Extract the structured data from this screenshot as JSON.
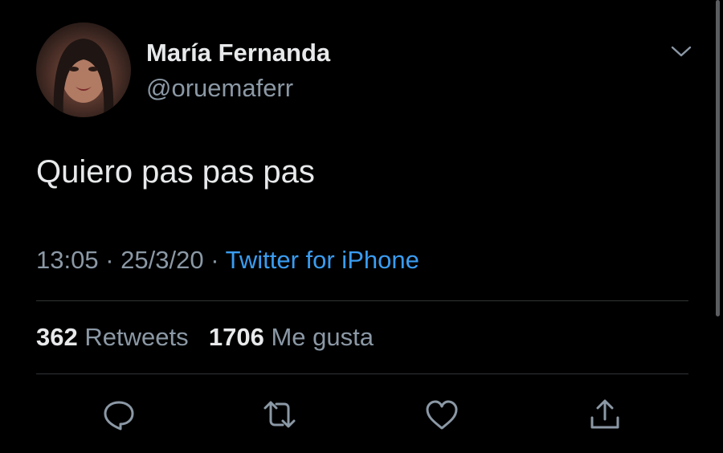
{
  "tweet": {
    "display_name": "María Fernanda",
    "handle": "@oruemaferr",
    "text": "Quiero pas pas pas",
    "time": "13:05",
    "date": "25/3/20",
    "separator": "·",
    "source": "Twitter for iPhone"
  },
  "stats": {
    "retweets_count": "362",
    "retweets_label": "Retweets",
    "likes_count": "1706",
    "likes_label": "Me gusta"
  },
  "actions": [
    {
      "icon": "reply-icon"
    },
    {
      "icon": "retweet-icon"
    },
    {
      "icon": "heart-icon"
    },
    {
      "icon": "share-icon"
    }
  ],
  "colors": {
    "background": "#000000",
    "text_primary": "#e7e9ea",
    "text_secondary": "#8b98a5",
    "link": "#3a9cf0",
    "divider": "#2f3336"
  }
}
